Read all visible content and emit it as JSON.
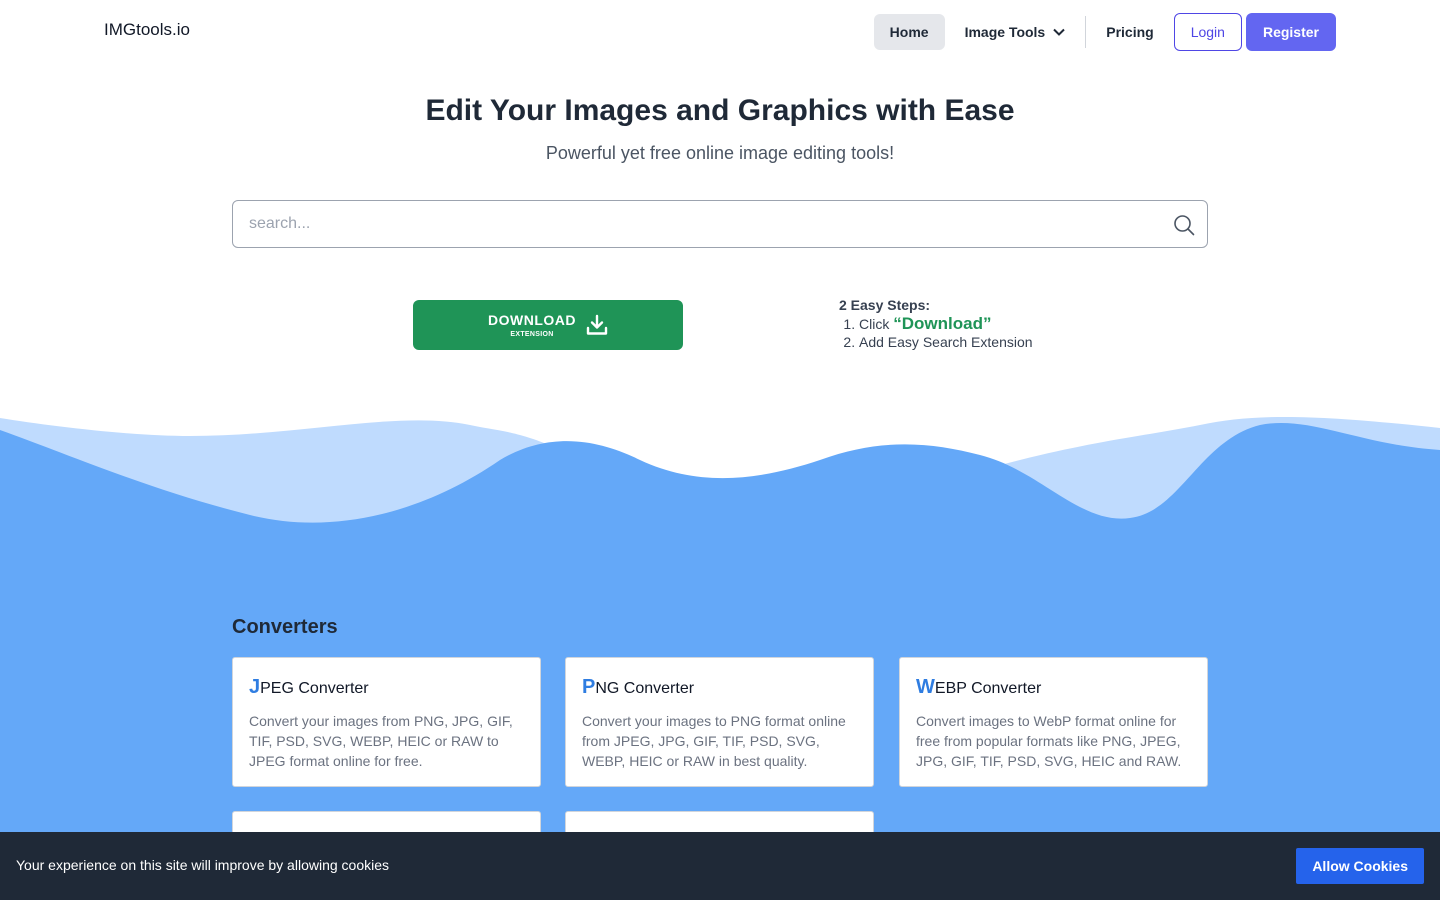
{
  "header": {
    "logo": "IMGtools.io",
    "nav": {
      "home": "Home",
      "image_tools": "Image Tools",
      "pricing": "Pricing",
      "login": "Login",
      "register": "Register"
    }
  },
  "hero": {
    "title": "Edit Your Images and Graphics with Ease",
    "subtitle": "Powerful yet free online image editing tools!"
  },
  "search": {
    "placeholder": "search..."
  },
  "download": {
    "label": "DOWNLOAD",
    "sublabel": "EXTENSION"
  },
  "steps": {
    "title": "2 Easy Steps:",
    "step1_prefix": "Click ",
    "step1_highlight": "“Download”",
    "step2": "Add Easy Search Extension"
  },
  "converters": {
    "title": "Converters",
    "cards": [
      {
        "initial": "J",
        "rest": "PEG Converter",
        "description": "Convert your images from PNG, JPG, GIF, TIF, PSD, SVG, WEBP, HEIC or RAW to JPEG format online for free."
      },
      {
        "initial": "P",
        "rest": "NG Converter",
        "description": "Convert your images to PNG format online from JPEG, JPG, GIF, TIF, PSD, SVG, WEBP, HEIC or RAW in best quality."
      },
      {
        "initial": "W",
        "rest": "EBP Converter",
        "description": "Convert images to WebP format online for free from popular formats like PNG, JPEG, JPG, GIF, TIF, PSD, SVG, HEIC and RAW."
      }
    ]
  },
  "cookie": {
    "message": "Your experience on this site will improve by allowing cookies",
    "button": "Allow Cookies"
  },
  "colors": {
    "brand_primary": "#6366f1",
    "download_green": "#1f9457",
    "section_blue": "#64a8f8",
    "wave_light": "#bfdbfe",
    "cookie_bg": "#1f2937",
    "cookie_button": "#2563eb"
  }
}
